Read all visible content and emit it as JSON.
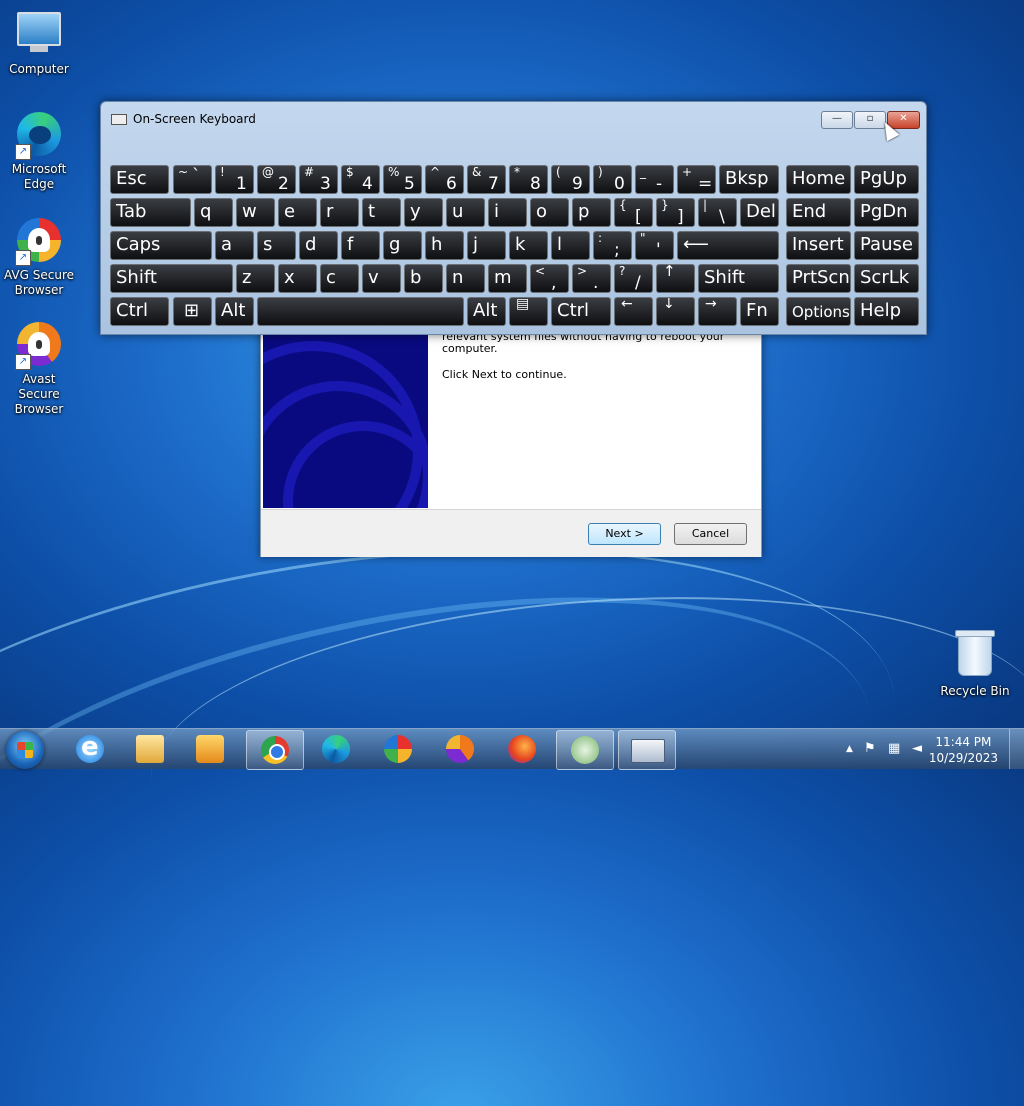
{
  "desktop": {
    "icons": [
      {
        "label": "Computer"
      },
      {
        "label": "Microsoft Edge"
      },
      {
        "label": "AVG Secure Browser"
      },
      {
        "label": "Avast Secure Browser"
      },
      {
        "label": "Recycle Bin"
      }
    ]
  },
  "installer": {
    "text_line1": "relevant system files without having to reboot your computer.",
    "text_line2": "Click Next to continue.",
    "next_label": "Next >",
    "cancel_label": "Cancel"
  },
  "osk": {
    "title": "On-Screen Keyboard",
    "minimize_glyph": "—",
    "restore_glyph": "▫",
    "close_glyph": "✕",
    "keys": {
      "esc": "Esc",
      "tilde_top": "~",
      "tilde_bot": "`",
      "k1_top": "!",
      "k1": "1",
      "k2_top": "@",
      "k2": "2",
      "k3_top": "#",
      "k3": "3",
      "k4_top": "$",
      "k4": "4",
      "k5_top": "%",
      "k5": "5",
      "k6_top": "^",
      "k6": "6",
      "k7_top": "&",
      "k7": "7",
      "k8_top": "*",
      "k8": "8",
      "k9_top": "(",
      "k9": "9",
      "k0_top": ")",
      "k0": "0",
      "minus_top": "_",
      "minus": "-",
      "equal_top": "+",
      "equal": "=",
      "bksp": "Bksp",
      "home": "Home",
      "pgup": "PgUp",
      "tab": "Tab",
      "q": "q",
      "w": "w",
      "e": "e",
      "r": "r",
      "t": "t",
      "y": "y",
      "u": "u",
      "i": "i",
      "o": "o",
      "p": "p",
      "lbracket_top": "{",
      "lbracket": "[",
      "rbracket_top": "}",
      "rbracket": "]",
      "backslash_top": "|",
      "backslash": "\\",
      "del": "Del",
      "end": "End",
      "pgdn": "PgDn",
      "caps": "Caps",
      "a": "a",
      "s": "s",
      "d": "d",
      "f": "f",
      "g": "g",
      "h": "h",
      "j": "j",
      "k": "k",
      "l": "l",
      "semicolon_top": ":",
      "semicolon": ";",
      "quote_top": "\"",
      "quote": "'",
      "enter": "⟵",
      "insert": "Insert",
      "pause": "Pause",
      "shift": "Shift",
      "z": "z",
      "x": "x",
      "c": "c",
      "v": "v",
      "b": "b",
      "n": "n",
      "m": "m",
      "comma_top": "<",
      "comma": ",",
      "period_top": ">",
      "period": ".",
      "slash_top": "?",
      "slash": "/",
      "up": "↑",
      "prtscn": "PrtScn",
      "scrlk": "ScrLk",
      "ctrl": "Ctrl",
      "win": "⊞",
      "alt": "Alt",
      "menu": "▤",
      "left": "←",
      "down": "↓",
      "right": "→",
      "fn": "Fn",
      "options": "Options",
      "help": "Help"
    }
  },
  "taskbar": {
    "clock_time": "11:44 PM",
    "clock_date": "10/29/2023",
    "tray_arrow": "▲",
    "tray_flag": "⚑",
    "tray_net": "▦",
    "tray_vol": "◄"
  }
}
